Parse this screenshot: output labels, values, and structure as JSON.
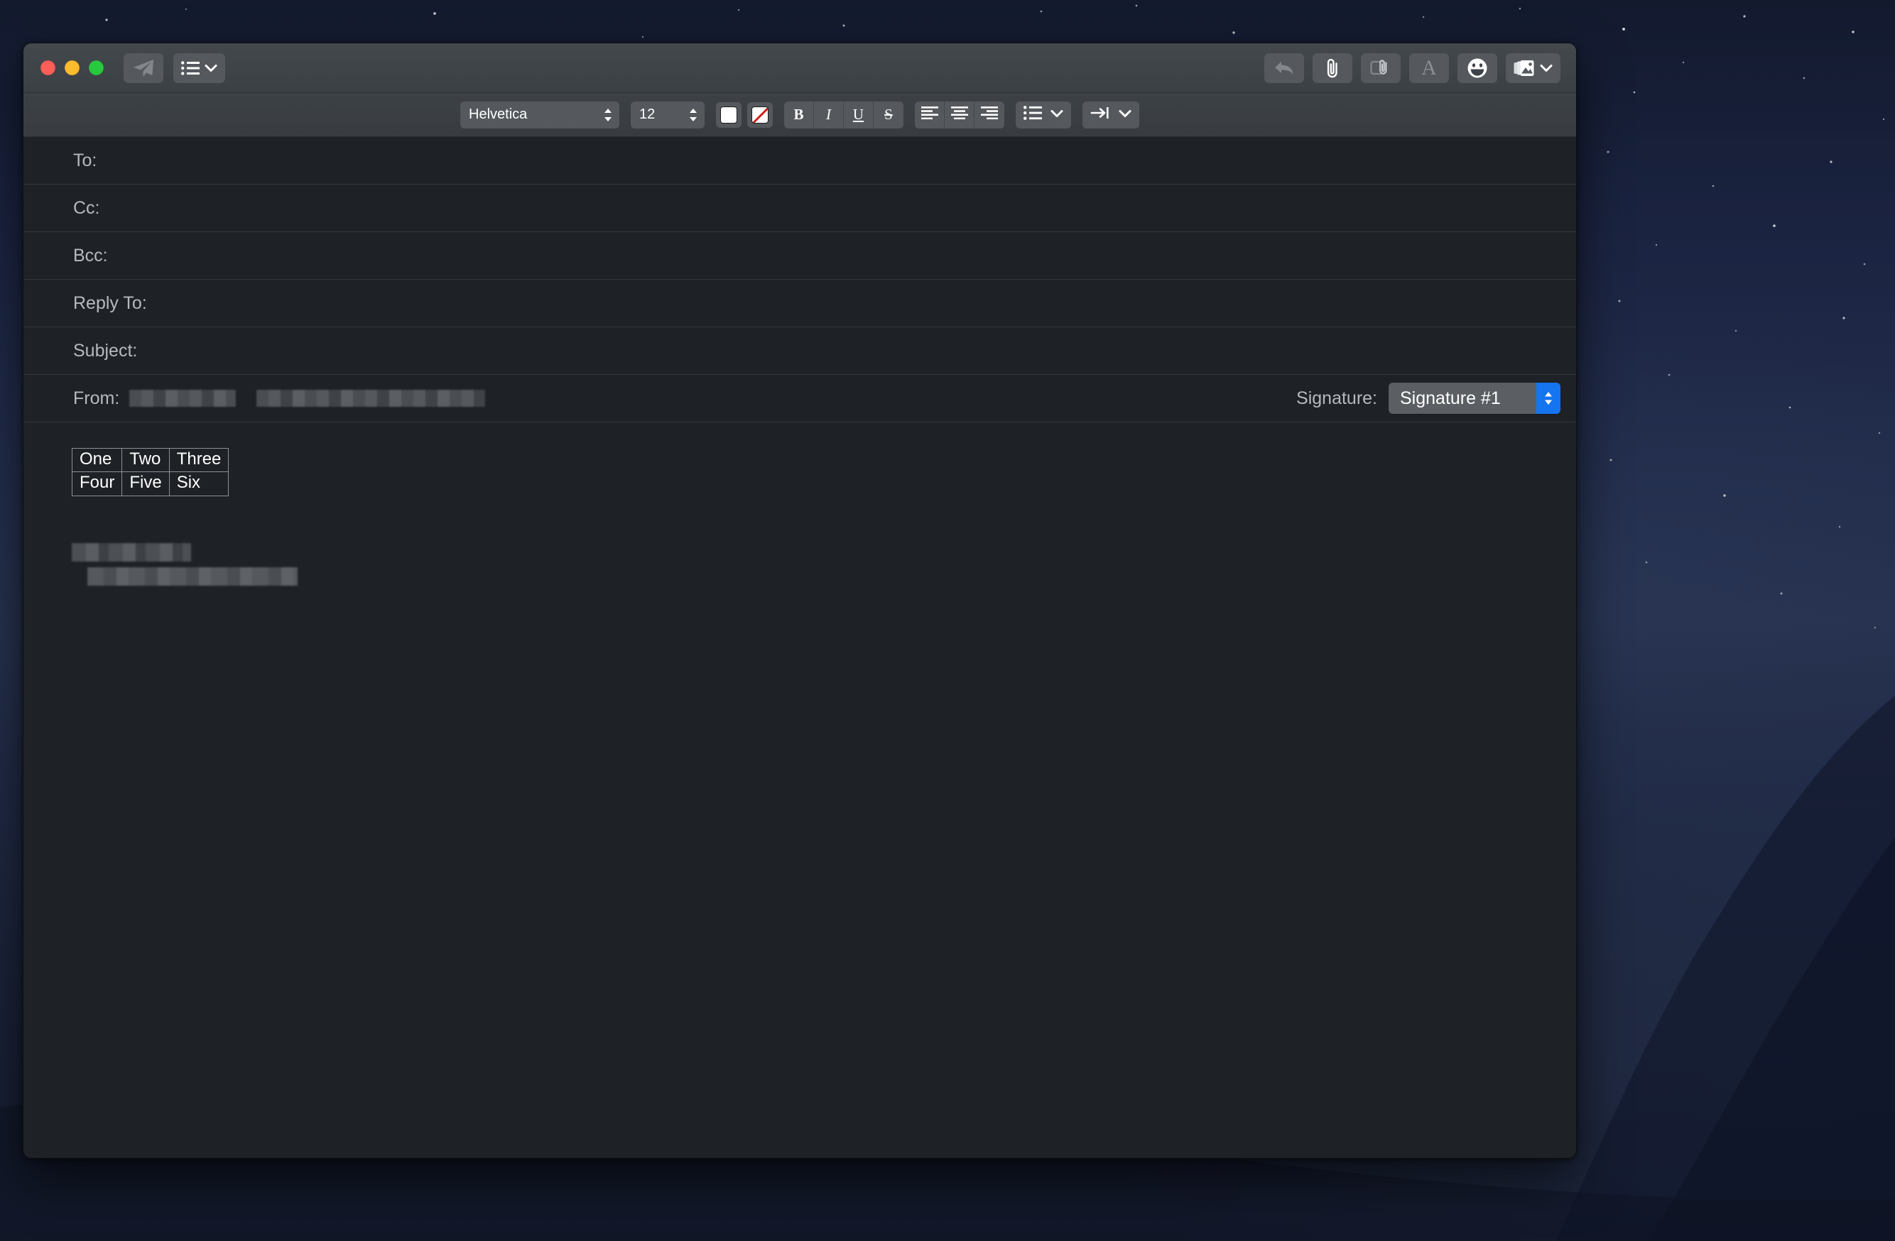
{
  "window": {
    "title": "",
    "traffic_lights": [
      {
        "name": "close",
        "color": "#fc5f57"
      },
      {
        "name": "minimize",
        "color": "#fdbc2e"
      },
      {
        "name": "zoom",
        "color": "#28c83f"
      }
    ]
  },
  "toolbar": {
    "left": [
      {
        "name": "send-button",
        "icon": "paper-plane-icon",
        "enabled": false
      },
      {
        "name": "header-fields-button",
        "icon": "list-icon",
        "menu": true,
        "enabled": true
      }
    ],
    "right": [
      {
        "name": "undo-button",
        "icon": "undo-arrow-icon",
        "enabled": false
      },
      {
        "name": "attach-button",
        "icon": "paperclip-icon",
        "enabled": true
      },
      {
        "name": "markup-button",
        "icon": "markup-icon",
        "enabled": false
      },
      {
        "name": "format-button",
        "icon": "letter-a-icon",
        "label": "A",
        "enabled": false
      },
      {
        "name": "emoji-button",
        "icon": "smiley-icon",
        "enabled": true
      },
      {
        "name": "photo-browser-button",
        "icon": "photos-icon",
        "menu": true,
        "enabled": true
      }
    ]
  },
  "format_bar": {
    "font_family": "Helvetica",
    "font_size": "12",
    "text_color": "#ffffff",
    "background_color": "none",
    "styles": [
      {
        "name": "bold",
        "glyph": "B"
      },
      {
        "name": "italic",
        "glyph": "I"
      },
      {
        "name": "underline",
        "glyph": "U"
      },
      {
        "name": "strikethrough",
        "glyph": "S"
      }
    ],
    "alignment": [
      {
        "name": "align-left"
      },
      {
        "name": "align-center"
      },
      {
        "name": "align-right"
      }
    ],
    "list_menu": {
      "name": "list-style",
      "icon": "bulleted-list-icon"
    },
    "indent_menu": {
      "name": "indent-level",
      "icon": "indent-icon"
    }
  },
  "headers": {
    "rows": [
      {
        "label": "To:",
        "value": "",
        "redacted": false
      },
      {
        "label": "Cc:",
        "value": "",
        "redacted": false
      },
      {
        "label": "Bcc:",
        "value": "",
        "redacted": false
      },
      {
        "label": "Reply To:",
        "value": "",
        "redacted": false
      },
      {
        "label": "Subject:",
        "value": "",
        "redacted": false
      },
      {
        "label": "From:",
        "value": "",
        "redacted": true
      }
    ],
    "signature": {
      "label": "Signature:",
      "selected": "Signature #1",
      "accent_color": "#1574ef"
    }
  },
  "message_body": {
    "table": {
      "rows": [
        [
          "One",
          "Two",
          "Three"
        ],
        [
          "Four",
          "Five",
          "Six"
        ]
      ]
    },
    "signature_block_redacted": true
  },
  "colors": {
    "titlebar": "#3f4449",
    "format_bar": "#3a3f44",
    "field_background": "#1e2125",
    "separator": "#34383d",
    "label_text": "#b6babe",
    "accent": "#1574ef",
    "desktop": "#1b2340"
  }
}
